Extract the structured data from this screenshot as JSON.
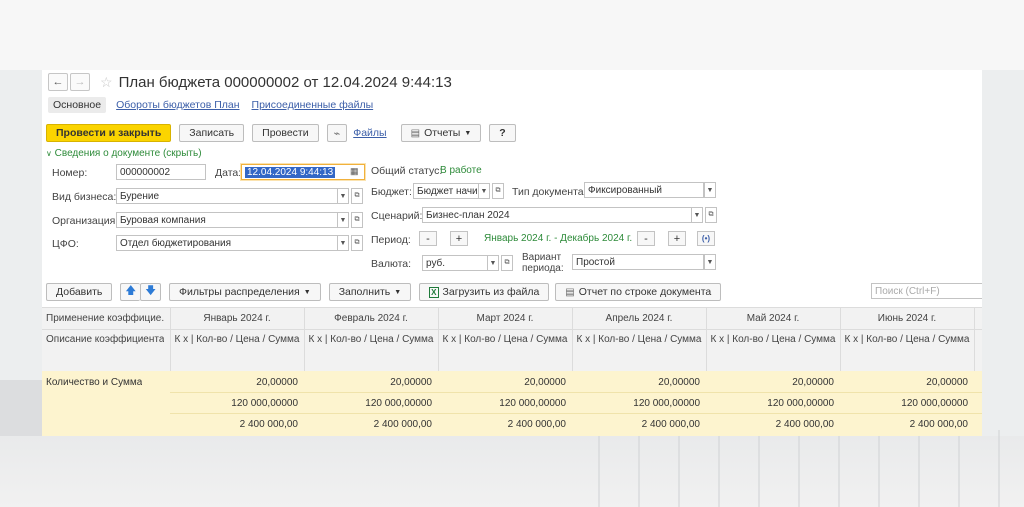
{
  "window": {
    "title": "План бюджета 000000002 от 12.04.2024 9:44:13",
    "nav_back": "←",
    "nav_forward": "→",
    "star": "☆"
  },
  "tabs": [
    "Основное",
    "Обороты бюджетов План",
    "Присоединенные файлы"
  ],
  "toolbar": {
    "post_close": "Провести и закрыть",
    "save": "Записать",
    "post": "Провести",
    "files": "Файлы",
    "reports": "Отчеты",
    "help": "?"
  },
  "section_header": "Сведения о документе (скрыть)",
  "form": {
    "number_label": "Номер:",
    "number_value": "000000002",
    "date_label": "Дата:",
    "date_value": "12.04.2024  9:44:13",
    "business_label": "Вид бизнеса:",
    "business_value": "Бурение",
    "org_label": "Организация:",
    "org_value": "Буровая компания",
    "cfo_label": "ЦФО:",
    "cfo_value": "Отдел бюджетирования",
    "status_label": "Общий статус:",
    "status_value": "В работе",
    "budget_label": "Бюджет:",
    "budget_value": "Бюджет начис",
    "doctype_label": "Тип документа:",
    "doctype_value": "Фиксированный",
    "scenario_label": "Сценарий:",
    "scenario_value": "Бизнес-план 2024",
    "period_label": "Период:",
    "period_value": "Январь 2024 г. - Декабрь 2024 г.",
    "currency_label": "Валюта:",
    "currency_value": "руб.",
    "variant_label": "Вариант периода:",
    "variant_value": "Простой"
  },
  "table_toolbar": {
    "add": "Добавить",
    "filters": "Фильтры распределения",
    "fill": "Заполнить",
    "load_file": "Загрузить из файла",
    "report_row": "Отчет по строке документа",
    "search_placeholder": "Поиск (Ctrl+F)"
  },
  "table": {
    "col1_header": "Применение коэффицие...",
    "col1_sub": "Описание коэффициента",
    "months": [
      "Январь 2024 г.",
      "Февраль 2024 г.",
      "Март 2024 г.",
      "Апрель 2024 г.",
      "Май 2024 г.",
      "Июнь 2024 г."
    ],
    "sub_header": "К х | Кол-во / Цена / Сумма",
    "row_label": "Количество и Сумма",
    "quantity": "20,00000",
    "price": "120 000,00000",
    "amount": "2 400 000,00"
  },
  "colors": {
    "primary": "#fbd400",
    "link": "#3b5ea8",
    "green": "#2e8b3a",
    "row_highlight": "#fdf4cf"
  }
}
